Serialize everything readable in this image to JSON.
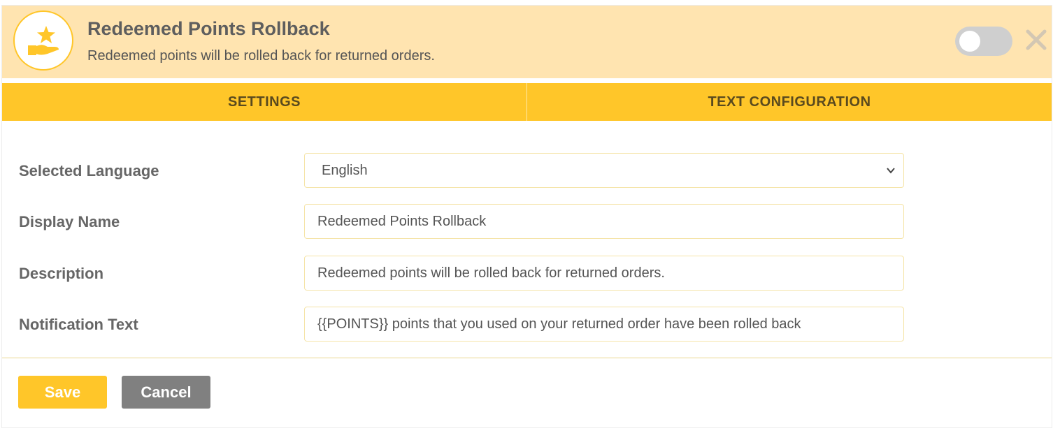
{
  "header": {
    "icon": "star-hand-icon",
    "title": "Redeemed Points Rollback",
    "description": "Redeemed points will be rolled back for returned orders.",
    "toggle_state": "off",
    "close_icon": "close-icon"
  },
  "tabs": [
    {
      "label": "SETTINGS"
    },
    {
      "label": "TEXT CONFIGURATION"
    }
  ],
  "form": {
    "language": {
      "label": "Selected Language",
      "value": "English"
    },
    "display_name": {
      "label": "Display Name",
      "value": "Redeemed Points Rollback"
    },
    "description": {
      "label": "Description",
      "value": "Redeemed points will be rolled back for returned orders."
    },
    "notification": {
      "label": "Notification Text",
      "value": "{{POINTS}} points that you used on your returned order have been rolled back"
    }
  },
  "buttons": {
    "save_label": "Save",
    "cancel_label": "Cancel"
  },
  "colors": {
    "header_bg": "#ffe4b0",
    "accent": "#ffc629",
    "cancel": "#808080"
  }
}
